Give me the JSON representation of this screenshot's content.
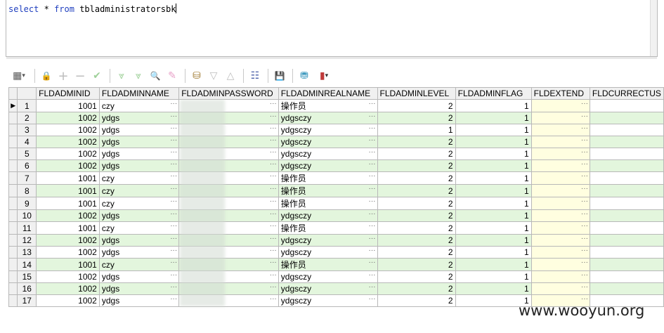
{
  "editor": {
    "keyword_select": "select",
    "star": "*",
    "keyword_from": "from",
    "table_name": "tbladministratorsbk"
  },
  "toolbar": {
    "icons": [
      "grid-view-icon",
      "lock-icon",
      "add-icon",
      "remove-icon",
      "check-icon",
      "filter-down-icon",
      "filter-clear-icon",
      "find-icon",
      "eraser-icon",
      "export-icon",
      "sort-down-icon",
      "sort-up-icon",
      "tree-icon",
      "save-icon",
      "database-icon",
      "chart-icon"
    ],
    "glyphs": [
      "▦",
      "🔒",
      "+",
      "−",
      "✔",
      "⩔",
      "⩔",
      "🔍",
      "✎",
      "⛁",
      "▽",
      "△",
      "☷",
      "💾",
      "⛃",
      "▮"
    ],
    "dropdown_glyph": "▾"
  },
  "columns": [
    "FLDADMINID",
    "FLDADMINNAME",
    "FLDADMINPASSWORD",
    "FLDADMINREALNAME",
    "FLDADMINLEVEL",
    "FLDADMINFLAG",
    "FLDEXTEND",
    "FLDCURRECTUS"
  ],
  "row_indicator": "▶",
  "ellipsis": "···",
  "rows": [
    {
      "n": "1",
      "id": "1001",
      "name": "czy",
      "real": "操作员",
      "level": "2",
      "flag": "1"
    },
    {
      "n": "2",
      "id": "1002",
      "name": "ydgs",
      "real": "ydgsczy",
      "level": "2",
      "flag": "1"
    },
    {
      "n": "3",
      "id": "1002",
      "name": "ydgs",
      "real": "ydgsczy",
      "level": "1",
      "flag": "1"
    },
    {
      "n": "4",
      "id": "1002",
      "name": "ydgs",
      "real": "ydgsczy",
      "level": "2",
      "flag": "1"
    },
    {
      "n": "5",
      "id": "1002",
      "name": "ydgs",
      "real": "ydgsczy",
      "level": "2",
      "flag": "1"
    },
    {
      "n": "6",
      "id": "1002",
      "name": "ydgs",
      "real": "ydgsczy",
      "level": "2",
      "flag": "1"
    },
    {
      "n": "7",
      "id": "1001",
      "name": "czy",
      "real": "操作员",
      "level": "2",
      "flag": "1"
    },
    {
      "n": "8",
      "id": "1001",
      "name": "czy",
      "real": "操作员",
      "level": "2",
      "flag": "1"
    },
    {
      "n": "9",
      "id": "1001",
      "name": "czy",
      "real": "操作员",
      "level": "2",
      "flag": "1"
    },
    {
      "n": "10",
      "id": "1002",
      "name": "ydgs",
      "real": "ydgsczy",
      "level": "2",
      "flag": "1"
    },
    {
      "n": "11",
      "id": "1001",
      "name": "czy",
      "real": "操作员",
      "level": "2",
      "flag": "1"
    },
    {
      "n": "12",
      "id": "1002",
      "name": "ydgs",
      "real": "ydgsczy",
      "level": "2",
      "flag": "1"
    },
    {
      "n": "13",
      "id": "1002",
      "name": "ydgs",
      "real": "ydgsczy",
      "level": "2",
      "flag": "1"
    },
    {
      "n": "14",
      "id": "1001",
      "name": "czy",
      "real": "操作员",
      "level": "2",
      "flag": "1"
    },
    {
      "n": "15",
      "id": "1002",
      "name": "ydgs",
      "real": "ydgsczy",
      "level": "2",
      "flag": "1"
    },
    {
      "n": "16",
      "id": "1002",
      "name": "ydgs",
      "real": "ydgsczy",
      "level": "2",
      "flag": "1"
    },
    {
      "n": "17",
      "id": "1002",
      "name": "ydgs",
      "real": "ydgsczy",
      "level": "2",
      "flag": "1"
    }
  ],
  "watermark": "www.wooyun.org",
  "colors": {
    "alt_row": "#e3f6dd",
    "extend_col": "#fffee0",
    "keyword": "#1f3fbf"
  }
}
